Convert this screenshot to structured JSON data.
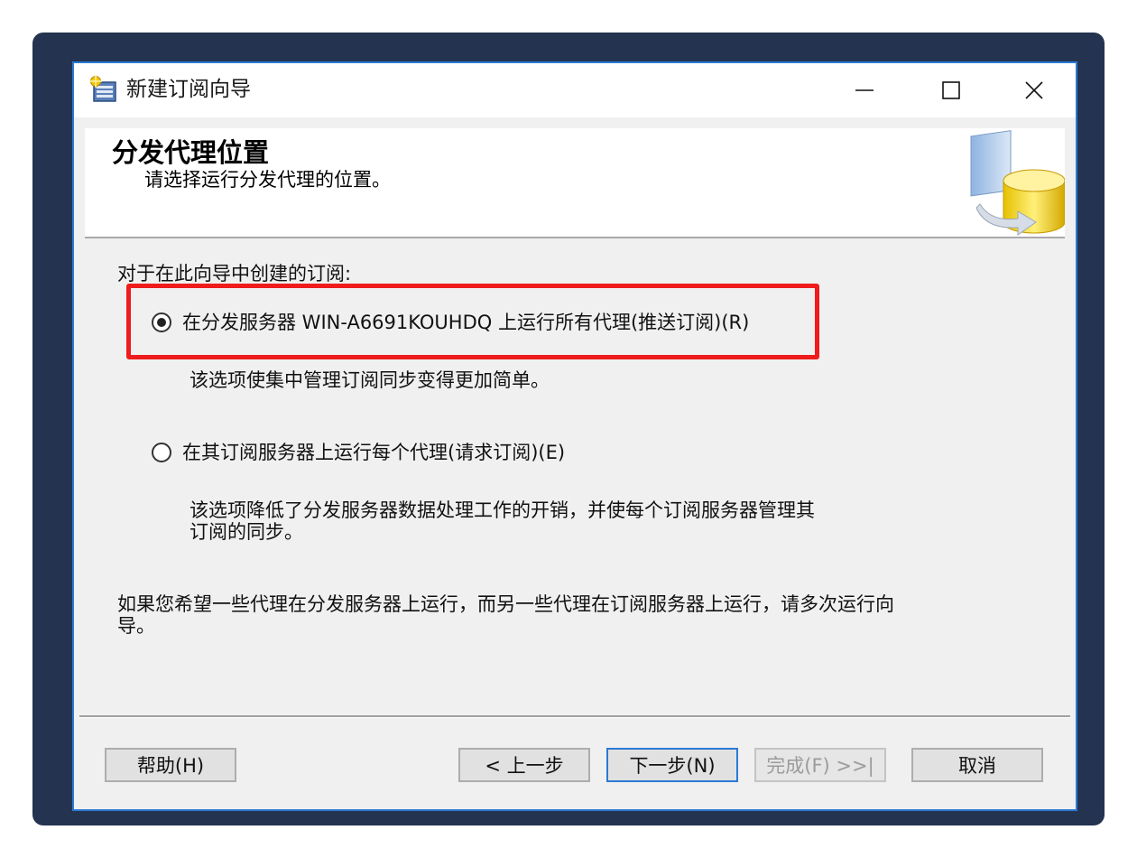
{
  "window": {
    "title": "新建订阅向导",
    "controls": {
      "minimize": "—",
      "maximize": "☐",
      "close": "✕"
    }
  },
  "header": {
    "title": "分发代理位置",
    "subtitle": "请选择运行分发代理的位置。"
  },
  "content": {
    "intro": "对于在此向导中创建的订阅:",
    "option_push": {
      "label": "在分发服务器 WIN-A6691KOUHDQ 上运行所有代理(推送订阅)(R)",
      "description": "该选项使集中管理订阅同步变得更加简单。",
      "selected": true
    },
    "option_pull": {
      "label": "在其订阅服务器上运行每个代理(请求订阅)(E)",
      "description_line1": "该选项降低了分发服务器数据处理工作的开销，并使每个订阅服务器管理其",
      "description_line2": "订阅的同步。",
      "selected": false
    },
    "note_line1": "如果您希望一些代理在分发服务器上运行，而另一些代理在订阅服务器上运行，请多次运行向",
    "note_line2": "导。"
  },
  "buttons": {
    "help": "帮助(H)",
    "back": "< 上一步",
    "next": "下一步(N)",
    "finish": "完成(F) >>|",
    "cancel": "取消"
  },
  "colors": {
    "highlight": "#ee1c1c",
    "backdrop": "#243350",
    "window_border": "#2b79d4"
  }
}
